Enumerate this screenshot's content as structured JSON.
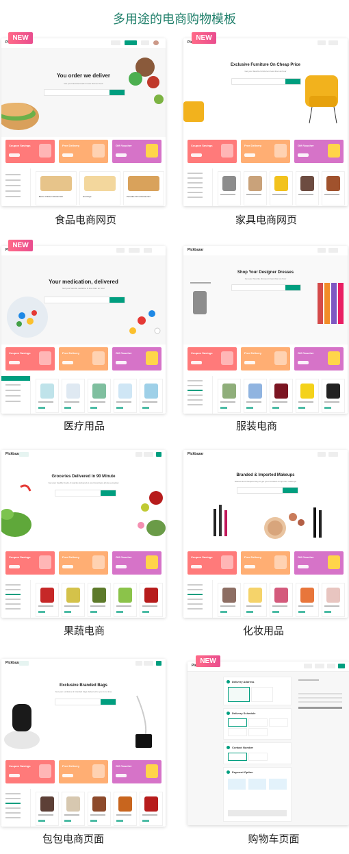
{
  "page": {
    "title": "多用途的电商购物模板",
    "badge_label": "NEW"
  },
  "colors": {
    "accent": "#009e7f",
    "title": "#1f7f6a",
    "promo_coupon": "#ff7a7a",
    "promo_delivery": "#ffae73",
    "promo_voucher": "#d673c8",
    "badge": "#ef5a8a"
  },
  "templates": [
    {
      "caption": "食品电商网页",
      "is_new": true,
      "hero_title": "You order we deliver",
      "promos": [
        "Coupon Savings",
        "Free Delivery",
        "Gift Voucher"
      ],
      "products": [
        "Bento Chicken Restaurant",
        "Hot Dogs",
        "Pancake Drive Restaurant"
      ]
    },
    {
      "caption": "家具电商网页",
      "is_new": true,
      "hero_title": "Exclusive Furniture On Cheap Price",
      "promos": [
        "Coupon Savings",
        "Free Delivery",
        "Gift Voucher"
      ]
    },
    {
      "caption": "医疗用品",
      "is_new": true,
      "hero_title": "Your medication, delivered",
      "promos": [
        "Coupon Savings",
        "Free Delivery",
        "Gift Voucher"
      ]
    },
    {
      "caption": "服装电商",
      "is_new": false,
      "hero_title": "Shop Your Designer Dresses",
      "promos": [
        "Coupon Savings",
        "Free Delivery",
        "Gift Voucher"
      ]
    },
    {
      "caption": "果蔬电商",
      "is_new": false,
      "hero_title": "Groceries Delivered in 90 Minute",
      "promos": [
        "Coupon Savings",
        "Free Delivery",
        "Gift Voucher"
      ]
    },
    {
      "caption": "化妆用品",
      "is_new": false,
      "hero_title": "Branded & Imported Makeups",
      "promos": [
        "Coupon Savings",
        "Free Delivery",
        "Gift Voucher"
      ]
    },
    {
      "caption": "包包电商页面",
      "is_new": false,
      "hero_title": "Exclusive Branded Bags",
      "promos": [
        "Coupon Savings",
        "Free Delivery",
        "Gift Voucher"
      ]
    },
    {
      "caption": "购物车页面",
      "is_new": true,
      "sections": [
        "Delivery Address",
        "Delivery Schedule",
        "Contact Number",
        "Payment Option"
      ]
    }
  ]
}
